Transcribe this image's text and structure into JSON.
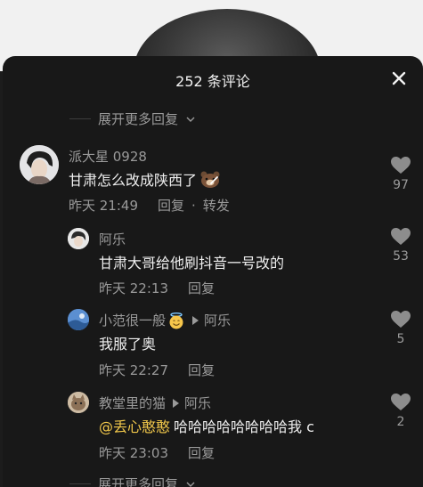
{
  "header": {
    "title": "252 条评论"
  },
  "expand_top": {
    "label": "展开更多回复"
  },
  "expand_bottom": {
    "label": "展开更多回复"
  },
  "comments": [
    {
      "user": "派大星 0928",
      "text": "甘肃怎么改成陕西了",
      "emoji": "bear-emoji",
      "time": "昨天 21:49",
      "reply": "回复",
      "dot": "·",
      "forward": "转发",
      "likes": "97"
    },
    {
      "user": "阿乐",
      "text": "甘肃大哥给他刷抖音一号改的",
      "time": "昨天 22:13",
      "reply": "回复",
      "likes": "53"
    },
    {
      "user": "小范很一般",
      "emoji": "halo-smile-emoji",
      "reply_to": "阿乐",
      "text": "我服了奥",
      "time": "昨天 22:27",
      "reply": "回复",
      "likes": "5"
    },
    {
      "user": "教堂里的猫",
      "reply_to": "阿乐",
      "mention": "@丢心憨憨",
      "text": "哈哈哈哈哈哈哈哈我 c",
      "time": "昨天 23:03",
      "reply": "回复",
      "likes": "2"
    }
  ],
  "colors": {
    "sheet_bg": "#181818",
    "text_primary": "#eeeeee",
    "text_secondary": "#9a9a9a",
    "mention": "#f3c94b"
  }
}
